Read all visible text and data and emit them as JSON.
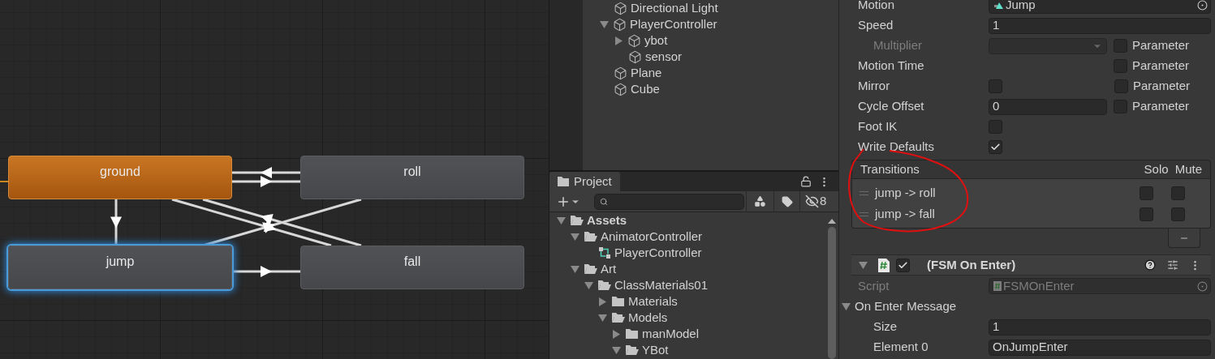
{
  "animator": {
    "states": [
      {
        "name": "ground",
        "kind": "default",
        "selected": false
      },
      {
        "name": "roll",
        "kind": "normal",
        "selected": false
      },
      {
        "name": "jump",
        "kind": "normal",
        "selected": true
      },
      {
        "name": "fall",
        "kind": "normal",
        "selected": false
      }
    ]
  },
  "hierarchy": {
    "items": [
      {
        "name": "Directional Light"
      },
      {
        "name": "PlayerController",
        "expanded": true,
        "children": [
          {
            "name": "ybot",
            "expanded": false
          },
          {
            "name": "sensor"
          }
        ]
      },
      {
        "name": "Plane"
      },
      {
        "name": "Cube"
      }
    ]
  },
  "project": {
    "tab": "Project",
    "hidden_count": "8",
    "tree": [
      {
        "name": "Assets",
        "kind": "folder",
        "expanded": true,
        "children": [
          {
            "name": "AnimatorController",
            "kind": "folder",
            "expanded": true,
            "children": [
              {
                "name": "PlayerController",
                "kind": "controller"
              }
            ]
          },
          {
            "name": "Art",
            "kind": "folder",
            "expanded": true,
            "children": [
              {
                "name": "ClassMaterials01",
                "kind": "folder",
                "expanded": true,
                "children": [
                  {
                    "name": "Materials",
                    "kind": "folder",
                    "expanded": false
                  },
                  {
                    "name": "Models",
                    "kind": "folder",
                    "expanded": true,
                    "children": [
                      {
                        "name": "manModel",
                        "kind": "folder",
                        "expanded": false
                      },
                      {
                        "name": "YBot",
                        "kind": "folder",
                        "expanded": true
                      }
                    ]
                  }
                ]
              }
            ]
          }
        ]
      }
    ]
  },
  "inspector": {
    "fields": [
      {
        "label": "Motion",
        "kind": "object",
        "value": "Jump"
      },
      {
        "label": "Speed",
        "kind": "text",
        "value": "1"
      },
      {
        "label": "Multiplier",
        "kind": "dropdown",
        "disabled": true,
        "parameter": {
          "label": "Parameter",
          "checked": false
        }
      },
      {
        "label": "Motion Time",
        "kind": "empty",
        "parameter": {
          "label": "Parameter",
          "checked": false
        }
      },
      {
        "label": "Mirror",
        "kind": "checkbox",
        "checked": false,
        "parameter": {
          "label": "Parameter",
          "checked": false
        }
      },
      {
        "label": "Cycle Offset",
        "kind": "short-text",
        "value": "0",
        "parameter": {
          "label": "Parameter",
          "checked": false
        }
      },
      {
        "label": "Foot IK",
        "kind": "checkbox",
        "checked": false
      },
      {
        "label": "Write Defaults",
        "kind": "checkbox",
        "checked": true
      }
    ],
    "transitions": {
      "title": "Transitions",
      "columns": [
        "Solo",
        "Mute"
      ],
      "rows": [
        {
          "label": "jump -> roll",
          "solo": false,
          "mute": false
        },
        {
          "label": "jump -> fall",
          "solo": false,
          "mute": false
        }
      ]
    },
    "component": {
      "title": "(FSM On Enter)",
      "enabled": true,
      "expanded": true,
      "script": {
        "label": "Script",
        "value": "FSMOnEnter",
        "disabled": true
      },
      "message": {
        "label": "On Enter Message",
        "expanded": true,
        "fields": [
          {
            "label": "Size",
            "value": "1"
          },
          {
            "label": "Element 0",
            "value": "OnJumpEnter"
          }
        ]
      }
    }
  }
}
